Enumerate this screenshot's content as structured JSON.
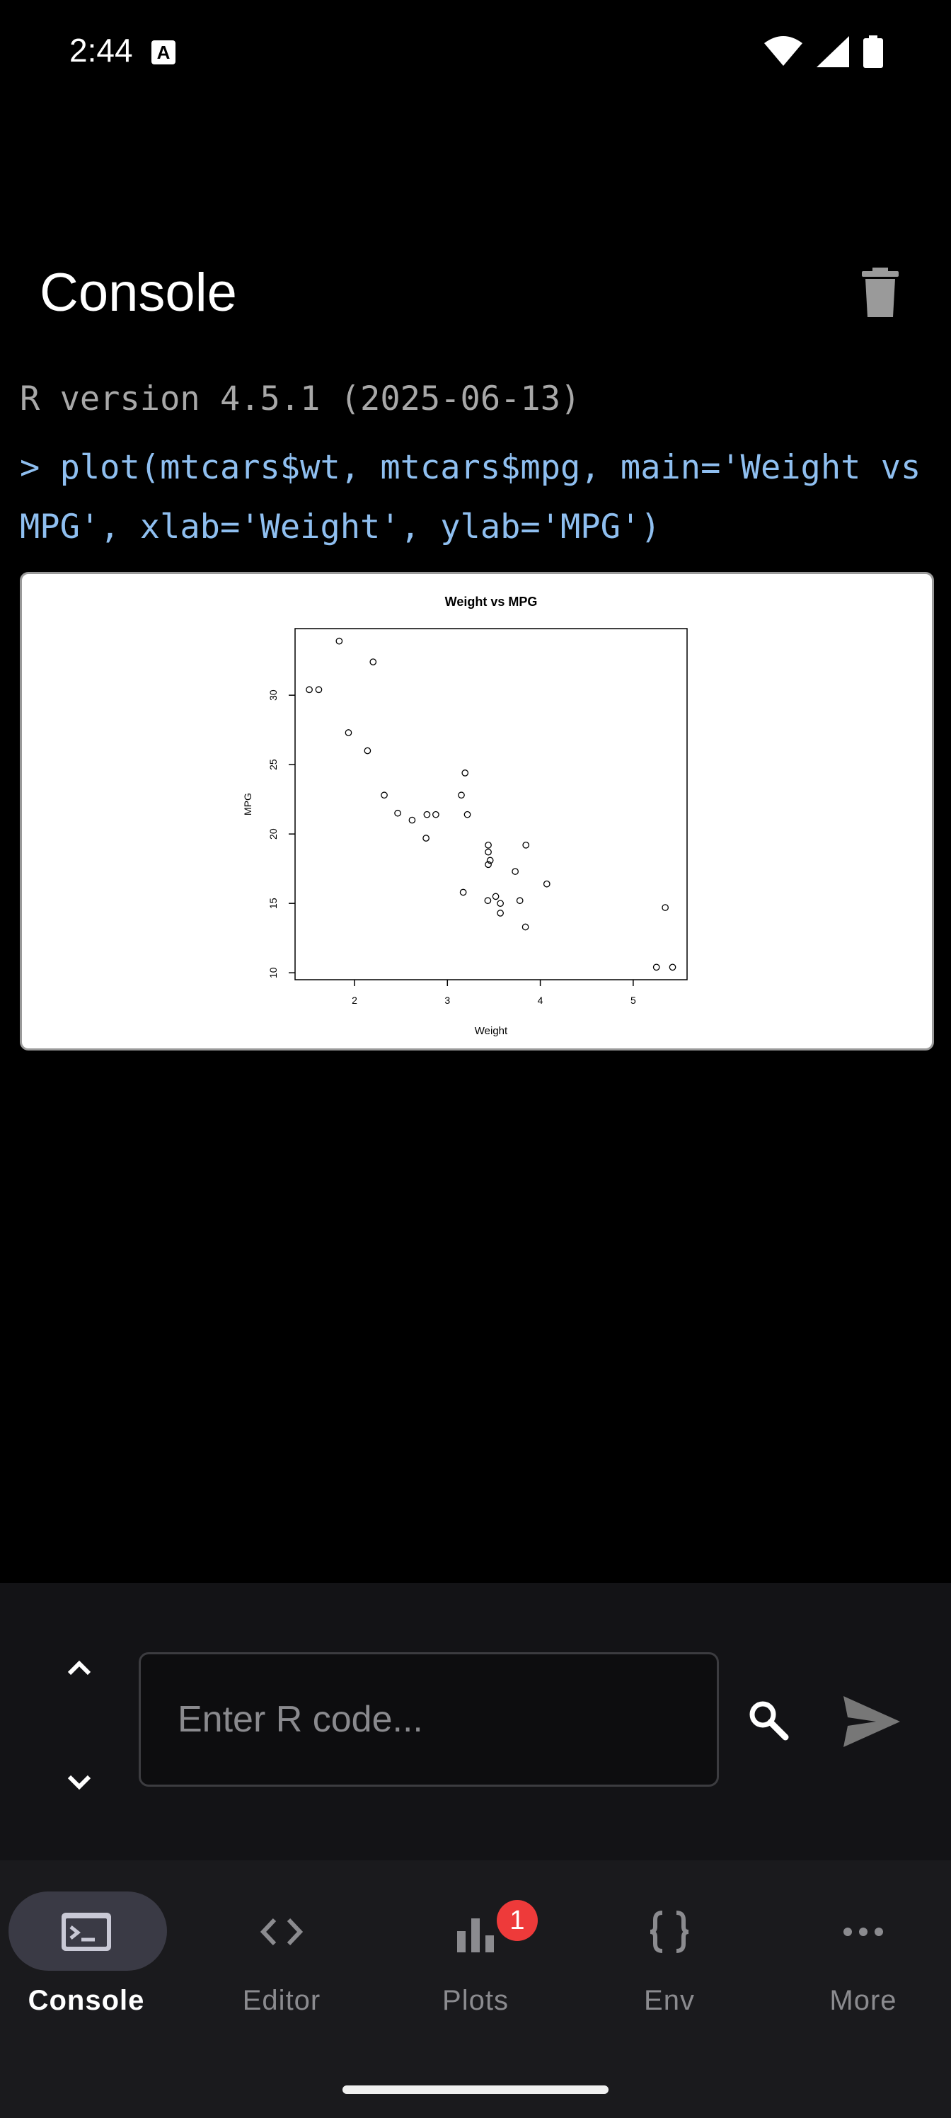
{
  "status_bar": {
    "time": "2:44",
    "app_icon": "A"
  },
  "header": {
    "title": "Console"
  },
  "console": {
    "version": "R version 4.5.1 (2025-06-13)",
    "command": "> plot(mtcars$wt, mtcars$mpg, main='Weight vs MPG', xlab='Weight', ylab='MPG')"
  },
  "input": {
    "placeholder": "Enter R code...",
    "value": ""
  },
  "nav": {
    "console": "Console",
    "editor": "Editor",
    "plots": "Plots",
    "plots_badge": "1",
    "env": "Env",
    "more": "More"
  },
  "colors": {
    "command_text": "#8fbff0",
    "version_text": "#a8a8a8",
    "badge": "#ee3a3a",
    "active_pill": "#3a3a45"
  },
  "chart_data": {
    "type": "scatter",
    "title": "Weight vs MPG",
    "xlabel": "Weight",
    "ylabel": "MPG",
    "xlim": [
      1.36,
      5.58
    ],
    "ylim": [
      9.5,
      34.8
    ],
    "x_ticks": [
      2,
      3,
      4,
      5
    ],
    "y_ticks": [
      10,
      15,
      20,
      25,
      30
    ],
    "grid": false,
    "x": [
      2.62,
      2.875,
      2.32,
      3.215,
      3.44,
      3.46,
      3.57,
      3.19,
      3.15,
      3.44,
      3.44,
      4.07,
      3.73,
      3.78,
      5.25,
      5.424,
      5.345,
      2.2,
      1.615,
      1.835,
      2.465,
      3.52,
      3.435,
      3.84,
      3.845,
      1.935,
      2.14,
      1.513,
      3.17,
      2.77,
      3.57,
      2.78
    ],
    "y": [
      21.0,
      21.4,
      22.8,
      21.4,
      18.7,
      18.1,
      14.3,
      24.4,
      22.8,
      19.2,
      17.8,
      16.4,
      17.3,
      15.2,
      10.4,
      10.4,
      14.7,
      32.4,
      30.4,
      33.9,
      21.5,
      15.5,
      15.2,
      13.3,
      19.2,
      27.3,
      26.0,
      30.4,
      15.8,
      19.7,
      15.0,
      21.4
    ]
  }
}
